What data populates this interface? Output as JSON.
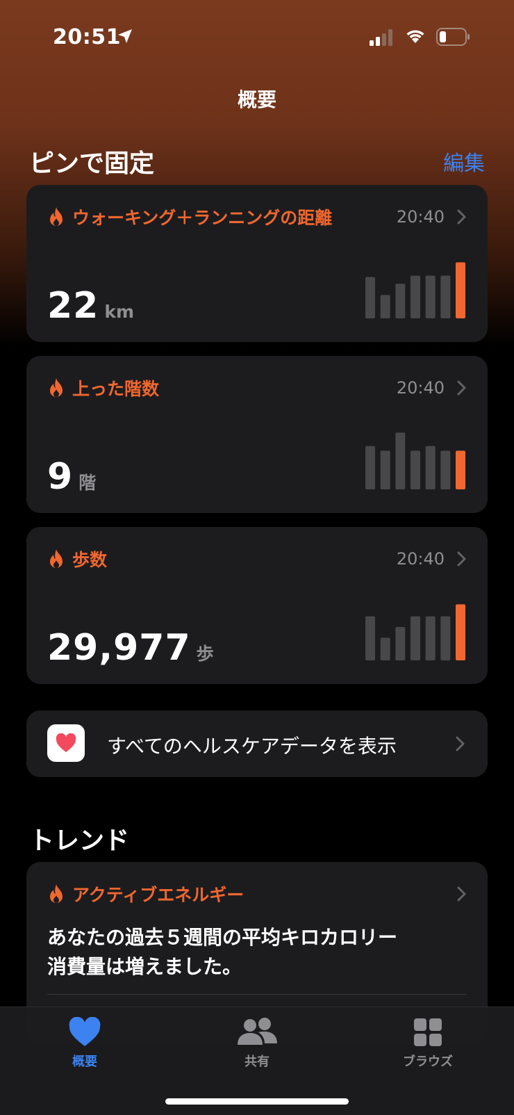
{
  "status_bar": {
    "time": "20:51"
  },
  "nav": {
    "title": "概要"
  },
  "pinned": {
    "title": "ピンで固定",
    "edit_label": "編集",
    "cards": [
      {
        "title": "ウォーキング＋ランニングの距離",
        "time": "20:40",
        "value": "22",
        "unit": "km",
        "bars": [
          0.62,
          0.35,
          0.52,
          0.64,
          0.64,
          0.64,
          0.84
        ]
      },
      {
        "title": "上った階数",
        "time": "20:40",
        "value": "9",
        "unit": "階",
        "bars": [
          0.65,
          0.58,
          0.85,
          0.58,
          0.65,
          0.58,
          0.58
        ]
      },
      {
        "title": "歩数",
        "time": "20:40",
        "value": "29,977",
        "unit": "歩",
        "bars": [
          0.66,
          0.34,
          0.5,
          0.66,
          0.66,
          0.66,
          0.84
        ]
      }
    ],
    "all_data_label": "すべてのヘルスケアデータを表示"
  },
  "trends": {
    "title": "トレンド",
    "card": {
      "title": "アクティブエネルギー",
      "text_line1": "あなたの過去５週間の平均キロカロリー",
      "text_line2": "消費量は増えました。"
    }
  },
  "tabs": [
    {
      "label": "概要",
      "icon": "heart-icon",
      "active": true
    },
    {
      "label": "共有",
      "icon": "people-icon",
      "active": false
    },
    {
      "label": "ブラウズ",
      "icon": "grid-icon",
      "active": false
    }
  ],
  "colors": {
    "accent": "#f0672f",
    "link": "#3c82f0",
    "active_tab": "#3c82f0",
    "inactive_tab": "#8e8e93",
    "bar_gray": "#48484a"
  }
}
